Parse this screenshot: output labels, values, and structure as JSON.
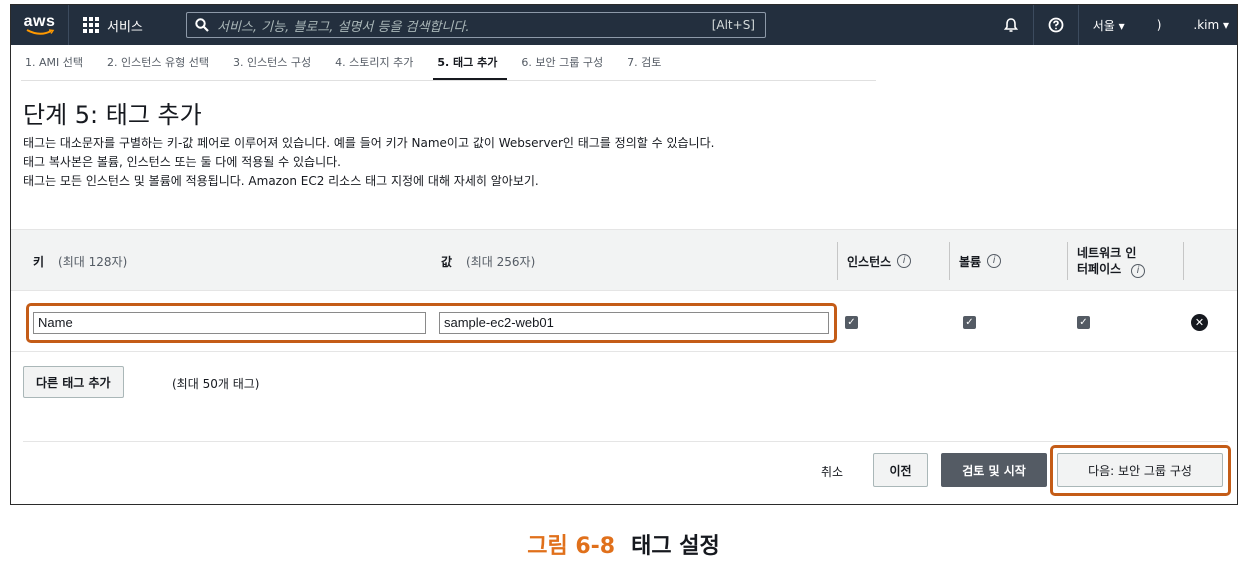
{
  "nav": {
    "logo_text": "aws",
    "services_label": "서비스",
    "search_placeholder": "서비스, 기능, 블로그, 설명서 등을 검색합니다.",
    "search_shortcut": "[Alt+S]",
    "region_label": "서울 ▾",
    "account_fragment": ")",
    "user_label": ".kim ▾"
  },
  "steps": [
    "1. AMI 선택",
    "2. 인스턴스 유형 선택",
    "3. 인스턴스 구성",
    "4. 스토리지 추가",
    "5. 태그 추가",
    "6. 보안 그룹 구성",
    "7. 검토"
  ],
  "page": {
    "title": "단계 5: 태그 추가",
    "desc1": "태그는 대소문자를 구별하는 키-값 페어로 이루어져 있습니다. 예를 들어 키가 Name이고 값이 Webserver인 태그를 정의할 수 있습니다.",
    "desc2": "태그 복사본은 볼륨, 인스턴스 또는 둘 다에 적용될 수 있습니다.",
    "desc3": "태그는 모든 인스턴스 및 볼륨에 적용됩니다. Amazon EC2 리소스 태그 지정에 대해 자세히 알아보기."
  },
  "table": {
    "key_header": "키",
    "key_hint": "(최대 128자)",
    "value_header": "값",
    "value_hint": "(최대 256자)",
    "instance_header": "인스턴스",
    "volume_header": "볼륨",
    "eni_header_line1": "네트워크 인",
    "eni_header_line2": "터페이스",
    "info_glyph": "i",
    "rows": [
      {
        "key": "Name",
        "value": "sample-ec2-web01",
        "instance": true,
        "volume": true,
        "eni": true
      }
    ]
  },
  "actions": {
    "add_tag": "다른 태그 추가",
    "add_tag_hint": "(최대 50개 태그)",
    "cancel": "취소",
    "previous": "이전",
    "review_launch": "검토 및 시작",
    "next": "다음: 보안 그룹 구성"
  },
  "caption": {
    "number": "그림 6-8",
    "title": "태그 설정"
  },
  "colors": {
    "nav_bg": "#232f3e",
    "highlight": "#c45c17",
    "caption_number": "#e0701b"
  }
}
